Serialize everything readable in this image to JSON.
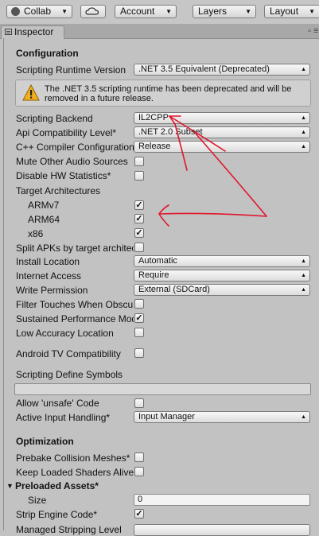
{
  "toolbar": {
    "collab_label": "Collab",
    "account_label": "Account",
    "layers_label": "Layers",
    "layout_label": "Layout"
  },
  "tab": {
    "label": "Inspector"
  },
  "configuration": {
    "heading": "Configuration",
    "scripting_runtime_label": "Scripting Runtime Version",
    "scripting_runtime_value": ".NET 3.5 Equivalent (Deprecated)",
    "deprecation_warning": "The .NET 3.5 scripting runtime has been deprecated and will be removed in a future release.",
    "scripting_backend_label": "Scripting Backend",
    "scripting_backend_value": "IL2CPP",
    "api_compat_label": "Api Compatibility Level*",
    "api_compat_value": ".NET 2.0 Subset",
    "cpp_config_label": "C++ Compiler Configuration",
    "cpp_config_value": "Release",
    "mute_audio_label": "Mute Other Audio Sources",
    "mute_audio_checked": false,
    "disable_hw_label": "Disable HW Statistics*",
    "disable_hw_checked": false,
    "target_arch_label": "Target Architectures",
    "armv7_label": "ARMv7",
    "armv7_checked": true,
    "arm64_label": "ARM64",
    "arm64_checked": true,
    "x86_label": "x86",
    "x86_checked": true,
    "split_apk_label": "Split APKs by target architecture",
    "split_apk_checked": false,
    "install_location_label": "Install Location",
    "install_location_value": "Automatic",
    "internet_access_label": "Internet Access",
    "internet_access_value": "Require",
    "write_permission_label": "Write Permission",
    "write_permission_value": "External (SDCard)",
    "filter_touches_label": "Filter Touches When Obscured",
    "filter_touches_checked": false,
    "sustained_perf_label": "Sustained Performance Mode",
    "sustained_perf_checked": true,
    "low_accuracy_label": "Low Accuracy Location",
    "low_accuracy_checked": false,
    "android_tv_label": "Android TV Compatibility",
    "android_tv_checked": false,
    "define_symbols_label": "Scripting Define Symbols",
    "define_symbols_value": "",
    "allow_unsafe_label": "Allow 'unsafe' Code",
    "allow_unsafe_checked": false,
    "active_input_label": "Active Input Handling*",
    "active_input_value": "Input Manager"
  },
  "optimization": {
    "heading": "Optimization",
    "prebake_label": "Prebake Collision Meshes*",
    "prebake_checked": false,
    "keep_shaders_label": "Keep Loaded Shaders Alive*",
    "keep_shaders_checked": false,
    "preloaded_assets_label": "Preloaded Assets*",
    "size_label": "Size",
    "size_value": "0",
    "strip_engine_label": "Strip Engine Code*",
    "strip_engine_checked": true,
    "managed_stripping_label": "Managed Stripping Level"
  },
  "colors": {
    "annotation": "#e0162b",
    "warning": "#f2b01e"
  }
}
